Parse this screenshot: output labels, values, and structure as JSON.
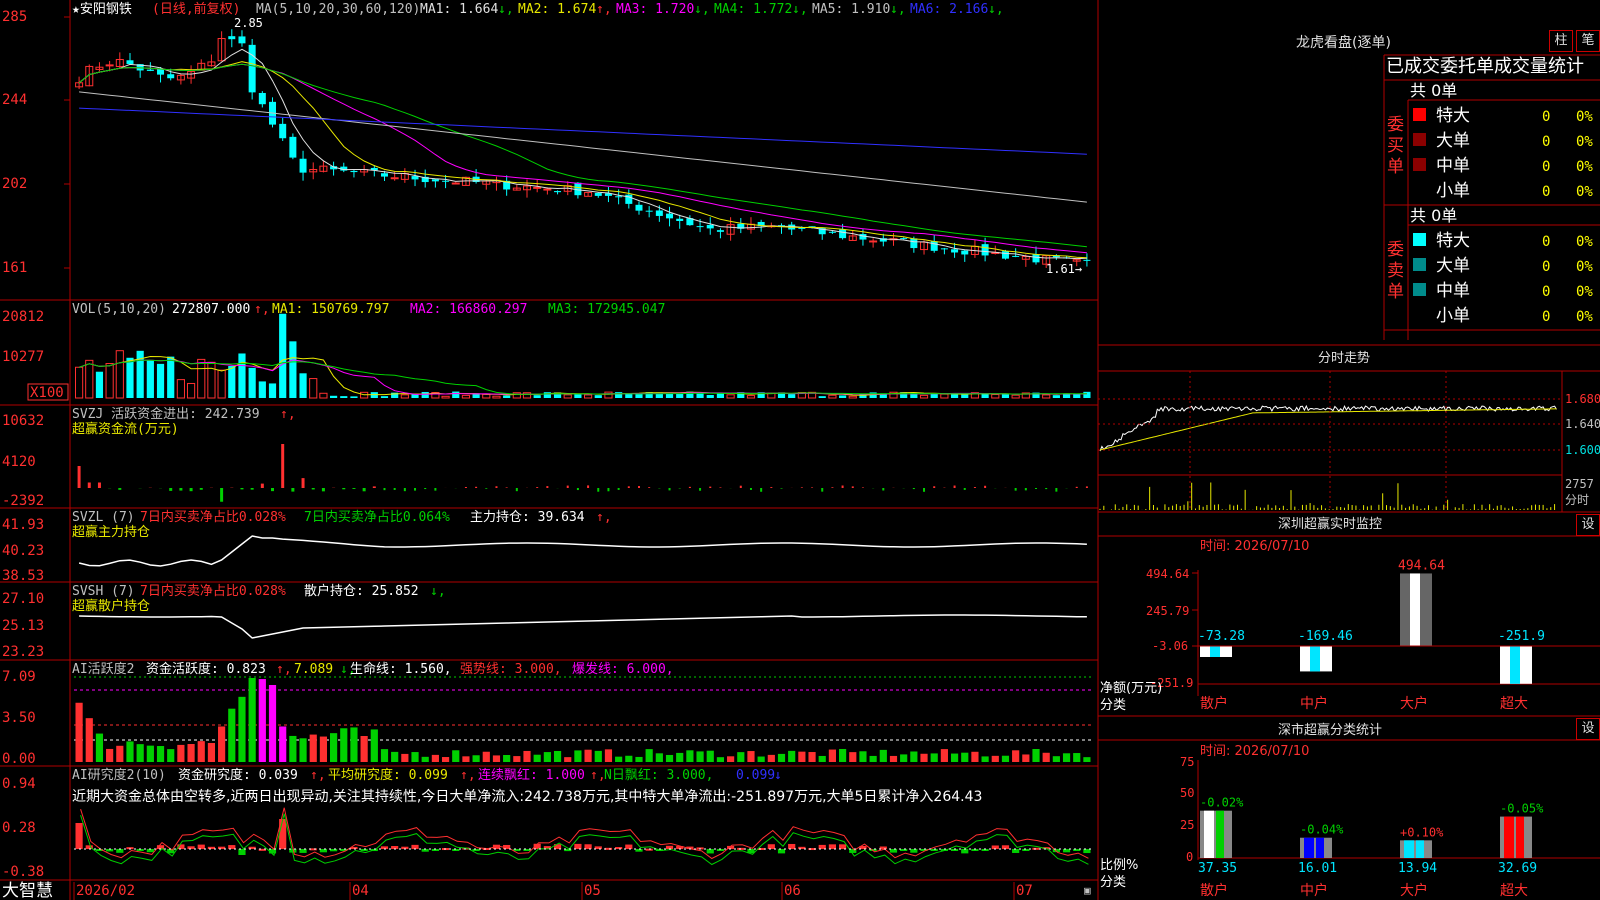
{
  "stock": {
    "name": "★安阳钢铁",
    "period_label": "(日线,前复权)",
    "ma_legend": "MA(5,10,20,30,60,120)",
    "ma_items": [
      {
        "label": "MA1: 1.664",
        "arrow": "↓",
        "color": "#e0e0e0"
      },
      {
        "label": "MA2: 1.674",
        "arrow": "↑",
        "color": "#e8e800"
      },
      {
        "label": "MA3: 1.720",
        "arrow": "↓",
        "color": "#ff00ff"
      },
      {
        "label": "MA4: 1.772",
        "arrow": "↓",
        "color": "#00d000"
      },
      {
        "label": "MA5: 1.910",
        "arrow": "↓",
        "color": "#c0c0c0"
      },
      {
        "label": "MA6: 2.166",
        "arrow": "↓",
        "color": "#3030ff"
      }
    ],
    "price_axis": [
      "285",
      "244",
      "202",
      "161"
    ],
    "high_marker": "2.85",
    "low_marker": "1.61→"
  },
  "vol": {
    "legend": "VOL(5,10,20)",
    "value": "272807.000",
    "ma1": "MA1: 150769.797",
    "ma2": "MA2: 166860.297",
    "ma3": "MA3: 172945.047",
    "axis": [
      "20812",
      "10277",
      "X100"
    ]
  },
  "svzj": {
    "legend": "SVZJ  活跃资金进出: 242.739",
    "sub": "超赢资金流(万元)",
    "axis": [
      "10632",
      "4120",
      "-2392"
    ]
  },
  "svzl": {
    "legend": "SVZL (7)",
    "a": "7日内买卖净占比0.028%",
    "b": "7日内买卖净占比0.064%",
    "c": "主力持仓: 39.634",
    "sub": "超赢主力持仓",
    "axis": [
      "41.93",
      "40.23",
      "38.53"
    ]
  },
  "svsh": {
    "legend": "SVSH (7)",
    "a": "7日内买卖净占比0.028%",
    "c": "散户持仓: 25.852",
    "sub": "超赢散户持仓",
    "axis": [
      "27.10",
      "25.13",
      "23.23"
    ]
  },
  "ai1": {
    "legend": "AI活跃度2",
    "a": "资金活跃度: 0.823",
    "b": "7.089",
    "c": "生命线: 1.560,",
    "d": "强势线: 3.000,",
    "e": "爆发线: 6.000,",
    "axis": [
      "7.09",
      "3.50",
      "0.00"
    ]
  },
  "ai2": {
    "legend": "AI研究度2(10)",
    "a": "资金研究度: 0.039",
    "b": "平均研究度: 0.099",
    "c": "连续飘红: 1.000",
    "d": "N日飘红: 3.000,",
    "e": "0.099",
    "comment": "近期大资金总体由空转多,近两日出现异动,关注其持续性,今日大单净流入:242.738万元,其中特大单净流出:-251.897万元,大单5日累计净入264.43",
    "axis": [
      "0.94",
      "0.28",
      "-0.38"
    ]
  },
  "bottom": {
    "brand": "大智慧",
    "dates": [
      "2026/02",
      "04",
      "05",
      "06",
      "07"
    ]
  },
  "right": {
    "title": "龙虎看盘(逐单)",
    "btn_zhu": "柱",
    "btn_bi": "笔",
    "table_title": "已成交委托单成交量统计",
    "buy_total": "共 0单",
    "buy_side": "委买单",
    "sell_total": "共 0单",
    "sell_side": "委卖单",
    "rows": [
      "特大",
      "大单",
      "中单",
      "小单"
    ],
    "zero": "0",
    "pct": "0%",
    "intraday_title": "分时走势",
    "intraday_axis": [
      "1.680",
      "1.640",
      "1.600"
    ],
    "intraday_vol": "2757",
    "intraday_vol_label": "分时",
    "monitor_title": "深圳超赢实时监控",
    "monitor_btn": "设",
    "monitor_time": "时间: 2026/07/10",
    "monitor_axis": [
      "494.64",
      "245.79",
      "-3.06",
      "-251.9"
    ],
    "monitor_ylabel": "净额(万元)",
    "monitor_xlabel": "分类",
    "classify_title": "深市超赢分类统计",
    "classify_btn": "设",
    "classify_time": "时间: 2026/07/10",
    "classify_axis": [
      "75",
      "50",
      "25",
      "0"
    ],
    "classify_ylabel": "比例%",
    "classify_xlabel": "分类"
  },
  "chart_data": [
    {
      "type": "bar",
      "title": "深圳超赢实时监控",
      "ylabel": "净额(万元)",
      "xlabel": "分类",
      "categories": [
        "散户",
        "中户",
        "大户",
        "超大"
      ],
      "values": [
        -73.28,
        -169.46,
        494.64,
        -251.9
      ],
      "labels": [
        "-73.28",
        "-169.46",
        "494.64",
        "-251.9"
      ],
      "ylim": [
        -251.9,
        494.64
      ]
    },
    {
      "type": "bar",
      "title": "深市超赢分类统计",
      "ylabel": "比例%",
      "xlabel": "分类",
      "categories": [
        "散户",
        "中户",
        "大户",
        "超大"
      ],
      "values": [
        37.35,
        16.01,
        13.94,
        32.69
      ],
      "changes": [
        "-0.02%",
        "-0.04%",
        "+0.10%",
        "-0.05%"
      ],
      "labels": [
        "37.35",
        "16.01",
        "13.94",
        "32.69"
      ],
      "ylim": [
        0,
        75
      ]
    }
  ]
}
